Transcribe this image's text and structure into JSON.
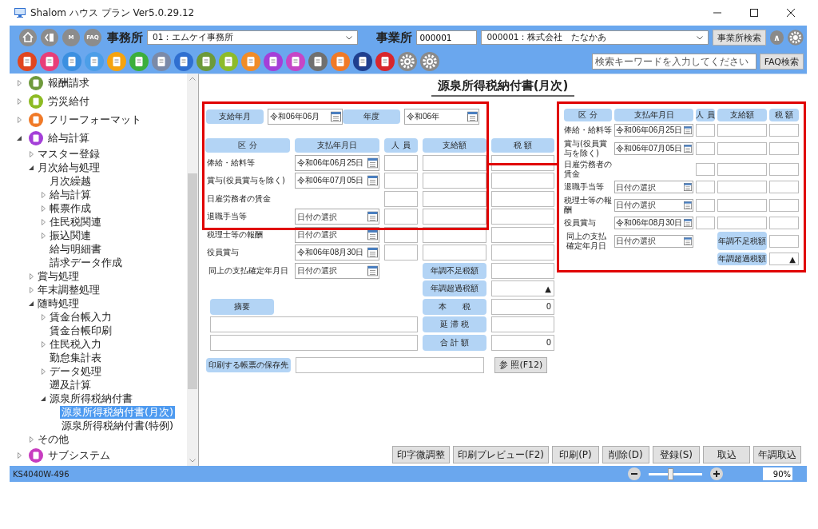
{
  "window": {
    "title": "Shalom ハウス プラン Ver5.0.29.12"
  },
  "header": {
    "nav_buttons": [
      {
        "kind": "home"
      },
      {
        "kind": "back"
      },
      {
        "kind": "text",
        "text": "M"
      },
      {
        "kind": "text",
        "text": "FAQ"
      }
    ],
    "office_label": "事務所",
    "office_select": "01：エムケイ事務所",
    "site_label": "事業所",
    "site_code": "000001",
    "site_select": "000001：株式会社　たなかあ",
    "site_search_button": "事業所検索",
    "collapse_button": "∧"
  },
  "app_bar": {
    "icons": [
      {
        "kind": "app",
        "color": "#e0461f"
      },
      {
        "kind": "app",
        "color": "#e83e78"
      },
      {
        "kind": "app",
        "color": "#3b8fe0"
      },
      {
        "kind": "app",
        "color": "#4c9ee8"
      },
      {
        "kind": "app",
        "color": "#f5a30f"
      },
      {
        "kind": "app",
        "color": "#3cae3c"
      },
      {
        "kind": "app",
        "color": "#7b8aa8"
      },
      {
        "kind": "app",
        "color": "#2f6fd0"
      },
      {
        "kind": "app",
        "color": "#6c9a3a"
      },
      {
        "kind": "app",
        "color": "#8dbb2a"
      },
      {
        "kind": "app",
        "color": "#f08c28"
      },
      {
        "kind": "app",
        "color": "#a43fd8"
      },
      {
        "kind": "app",
        "color": "#c646c6"
      },
      {
        "kind": "app",
        "color": "#707070"
      },
      {
        "kind": "app",
        "color": "#f07a28"
      },
      {
        "kind": "app",
        "color": "#1f3f8f"
      },
      {
        "kind": "app",
        "color": "#d8262c"
      },
      {
        "kind": "gear",
        "color": "#8a8a8a"
      },
      {
        "kind": "gear",
        "color": "#8a8a8a"
      }
    ],
    "search": {
      "placeholder": "検索キーワードを入力してください"
    },
    "search_button": "FAQ検索"
  },
  "sidebar": {
    "items": [
      {
        "label": "報酬請求",
        "color": "#6f9a3c",
        "expanded": false,
        "selected": false
      },
      {
        "label": "労災給付",
        "color": "#8dbb22",
        "expanded": false,
        "selected": false
      },
      {
        "label": "フリーフォーマット",
        "color": "#f07a28",
        "expanded": false,
        "selected": false
      },
      {
        "label": "給与計算",
        "color": "#a43fd8",
        "expanded": true,
        "selected": false,
        "children": [
          {
            "label": "マスター登録",
            "expanded": false,
            "selected": false
          },
          {
            "label": "月次給与処理",
            "expanded": true,
            "selected": false,
            "children": [
              {
                "label": "月次繰越",
                "selected": false
              },
              {
                "label": "給与計算",
                "expanded": false,
                "selected": false
              },
              {
                "label": "帳票作成",
                "expanded": false,
                "selected": false
              },
              {
                "label": "住民税関連",
                "expanded": false,
                "selected": false
              },
              {
                "label": "振込関連",
                "expanded": false,
                "selected": false
              },
              {
                "label": "給与明細書",
                "selected": false
              },
              {
                "label": "請求データ作成",
                "selected": false
              }
            ]
          },
          {
            "label": "賞与処理",
            "expanded": false,
            "selected": false
          },
          {
            "label": "年末調整処理",
            "expanded": false,
            "selected": false
          },
          {
            "label": "随時処理",
            "expanded": true,
            "selected": false,
            "children": [
              {
                "label": "賃金台帳入力",
                "expanded": false,
                "selected": false
              },
              {
                "label": "賃金台帳印刷",
                "selected": false
              },
              {
                "label": "住民税入力",
                "expanded": false,
                "selected": false
              },
              {
                "label": "勤怠集計表",
                "selected": false
              },
              {
                "label": "データ処理",
                "expanded": false,
                "selected": false
              },
              {
                "label": "遡及計算",
                "selected": false
              },
              {
                "label": "源泉所得税納付書",
                "expanded": true,
                "selected": false,
                "children": [
                  {
                    "label": "源泉所得税納付書(月次)",
                    "selected": true
                  },
                  {
                    "label": "源泉所得税納付書(特例)",
                    "selected": false
                  }
                ]
              }
            ]
          },
          {
            "label": "その他",
            "expanded": false,
            "selected": false
          }
        ]
      },
      {
        "label": "サブシステム",
        "color": "#c83cc0",
        "expanded": false,
        "selected": false
      }
    ]
  },
  "form": {
    "title": "源泉所得税納付書(月次)",
    "period": [
      {
        "label": "支給年月",
        "value": "令和06年06月"
      },
      {
        "label": "年度",
        "value": "令和06年"
      }
    ],
    "grid": {
      "columns": [
        "区 分",
        "支払年月日",
        "人 員",
        "支給額",
        "税 額"
      ],
      "rows": [
        {
          "kind": "full",
          "label": "俸給・給料等",
          "date": {
            "value": "令和06年06月25日"
          }
        },
        {
          "kind": "full",
          "label": "賞与(役員賞与を除く)",
          "date": {
            "value": "令和06年07月05日"
          }
        },
        {
          "kind": "no_date",
          "label": "日雇労務者の賃金"
        },
        {
          "kind": "full",
          "label": "退職手当等",
          "date": {
            "placeholder": "日付の選択"
          }
        },
        {
          "kind": "full",
          "label": "税理士等の報酬",
          "date": {
            "placeholder": "日付の選択"
          }
        },
        {
          "kind": "full",
          "label": "役員賞与",
          "date": {
            "value": "令和06年08月30日"
          }
        },
        {
          "kind": "confirm_date",
          "label": "同上の支払確定年月日",
          "date": {
            "placeholder": "日付の選択"
          }
        }
      ],
      "adjustments": [
        {
          "label": "年調不足税額"
        },
        {
          "label": "年調超過税額",
          "value": "▲"
        },
        {
          "label": "本　　税",
          "value": "0"
        },
        {
          "label": "延 滞 税"
        },
        {
          "label": "合 計 額",
          "value": "0"
        }
      ],
      "memo_label": "摘要"
    },
    "save_path": {
      "label": "印刷する帳票の保存先",
      "browse_button": "参 照(F12)"
    },
    "actions": [
      "印字微調整",
      "印刷プレビュー(F2)",
      "印刷(P)",
      "削除(D)",
      "登録(S)",
      "取込",
      "年調取込"
    ]
  },
  "annotation": {
    "columns": [
      "区 分",
      "支払年月日",
      "人 員",
      "支給額",
      "税 額"
    ],
    "rows": [
      {
        "kind": "full",
        "label": "俸給・給料等",
        "date": {
          "value": "令和06年06月25日"
        }
      },
      {
        "kind": "full",
        "label": "賞与(役員賞与を除く)",
        "date": {
          "value": "令和06年07月05日"
        }
      },
      {
        "kind": "no_date",
        "label": "日雇労務者の賃金"
      },
      {
        "kind": "full",
        "label": "退職手当等",
        "date": {
          "placeholder": "日付の選択"
        }
      },
      {
        "kind": "full",
        "label": "税理士等の報酬",
        "date": {
          "placeholder": "日付の選択"
        }
      },
      {
        "kind": "full",
        "label": "役員賞与",
        "date": {
          "value": "令和06年08月30日"
        }
      },
      {
        "kind": "confirm_date",
        "label": "同上の支払確定年月日",
        "date": {
          "placeholder": "日付の選択"
        }
      }
    ],
    "adjustments": [
      {
        "label": "年調不足税額"
      },
      {
        "label": "年調超過税額",
        "value": "▲"
      }
    ]
  },
  "status_bar": {
    "screen_id": "KS4040W-496",
    "zoom": {
      "level": 0.4,
      "value": "90%"
    }
  }
}
